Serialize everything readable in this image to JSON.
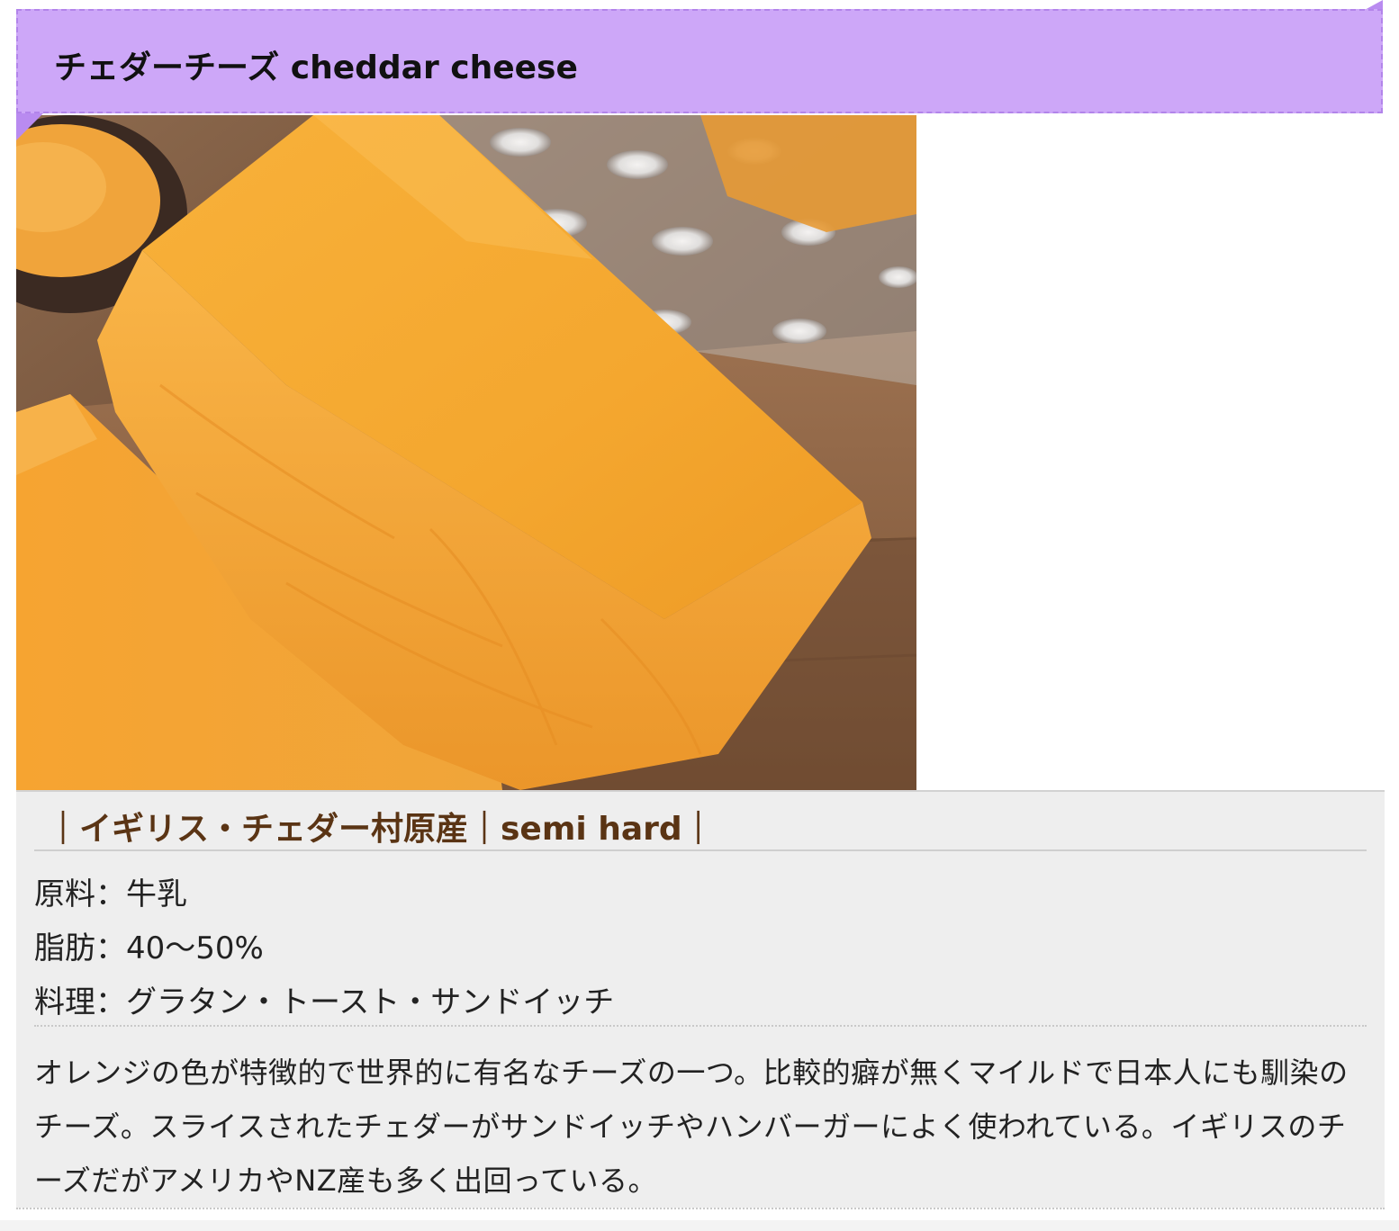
{
  "header": {
    "title": "チェダーチーズ cheddar cheese"
  },
  "photo": {
    "subject": "cheddar-cheese-photo"
  },
  "info": {
    "subtitle": "｜イギリス・チェダー村原産｜semi hard｜",
    "specs": [
      "原料：牛乳",
      "脂肪：40〜50%",
      "料理：グラタン・トースト・サンドイッチ"
    ],
    "description": "オレンジの色が特徴的で世界的に有名なチーズの一つ。比較的癖が無くマイルドで日本人にも馴染のチーズ。スライスされたチェダーがサンドイッチやハンバーガーによく使われている。イギリスのチーズだがアメリカやNZ産も多く出回っている。"
  },
  "colors": {
    "title_bar": "#cda7f8",
    "title_border": "#b284ea",
    "subtitle_text": "#5a3414",
    "panel_bg": "#eeeeee",
    "cheese": "#f3a531"
  }
}
